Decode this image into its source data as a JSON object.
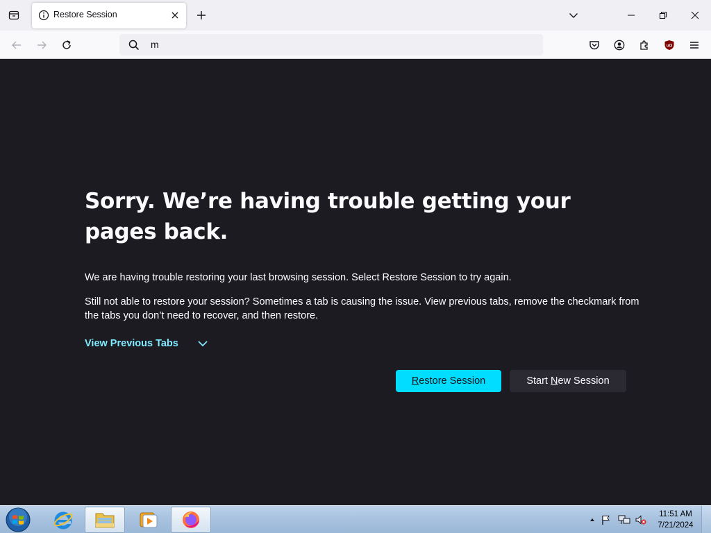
{
  "tab": {
    "title": "Restore Session",
    "close_glyph": "✕"
  },
  "toolbar": {
    "new_tab_glyph": "+"
  },
  "urlbar": {
    "value": "m"
  },
  "content": {
    "headline": "Sorry. We’re having trouble getting your pages back.",
    "para1": "We are having trouble restoring your last browsing session. Select Restore Session to try again.",
    "para2": "Still not able to restore your session? Sometimes a tab is causing the issue. View previous tabs, remove the checkmark from the tabs you don’t need to recover, and then restore.",
    "view_previous_tabs": "View Previous Tabs",
    "restore_button": {
      "mnemonic": "R",
      "rest": "estore Session"
    },
    "new_session_button": {
      "before": "Start ",
      "mnemonic": "N",
      "after": "ew Session"
    }
  },
  "taskbar": {
    "time": "11:51 AM",
    "date": "7/21/2024"
  },
  "colors": {
    "page_bg": "#1c1b22",
    "accent": "#00ddff",
    "link": "#80ebff",
    "secondary_button": "#2b2a33"
  },
  "icons": [
    "firefox-view-icon",
    "info-icon",
    "close-icon",
    "plus-icon",
    "chevron-down-icon",
    "minimize-icon",
    "restore-icon",
    "back-icon",
    "forward-icon",
    "reload-icon",
    "search-icon",
    "pocket-icon",
    "account-icon",
    "extensions-icon",
    "ublock-icon",
    "menu-icon",
    "windows-start-icon",
    "ie-icon",
    "explorer-icon",
    "media-player-icon",
    "firefox-icon",
    "flag-icon",
    "network-icon",
    "volume-muted-icon"
  ]
}
